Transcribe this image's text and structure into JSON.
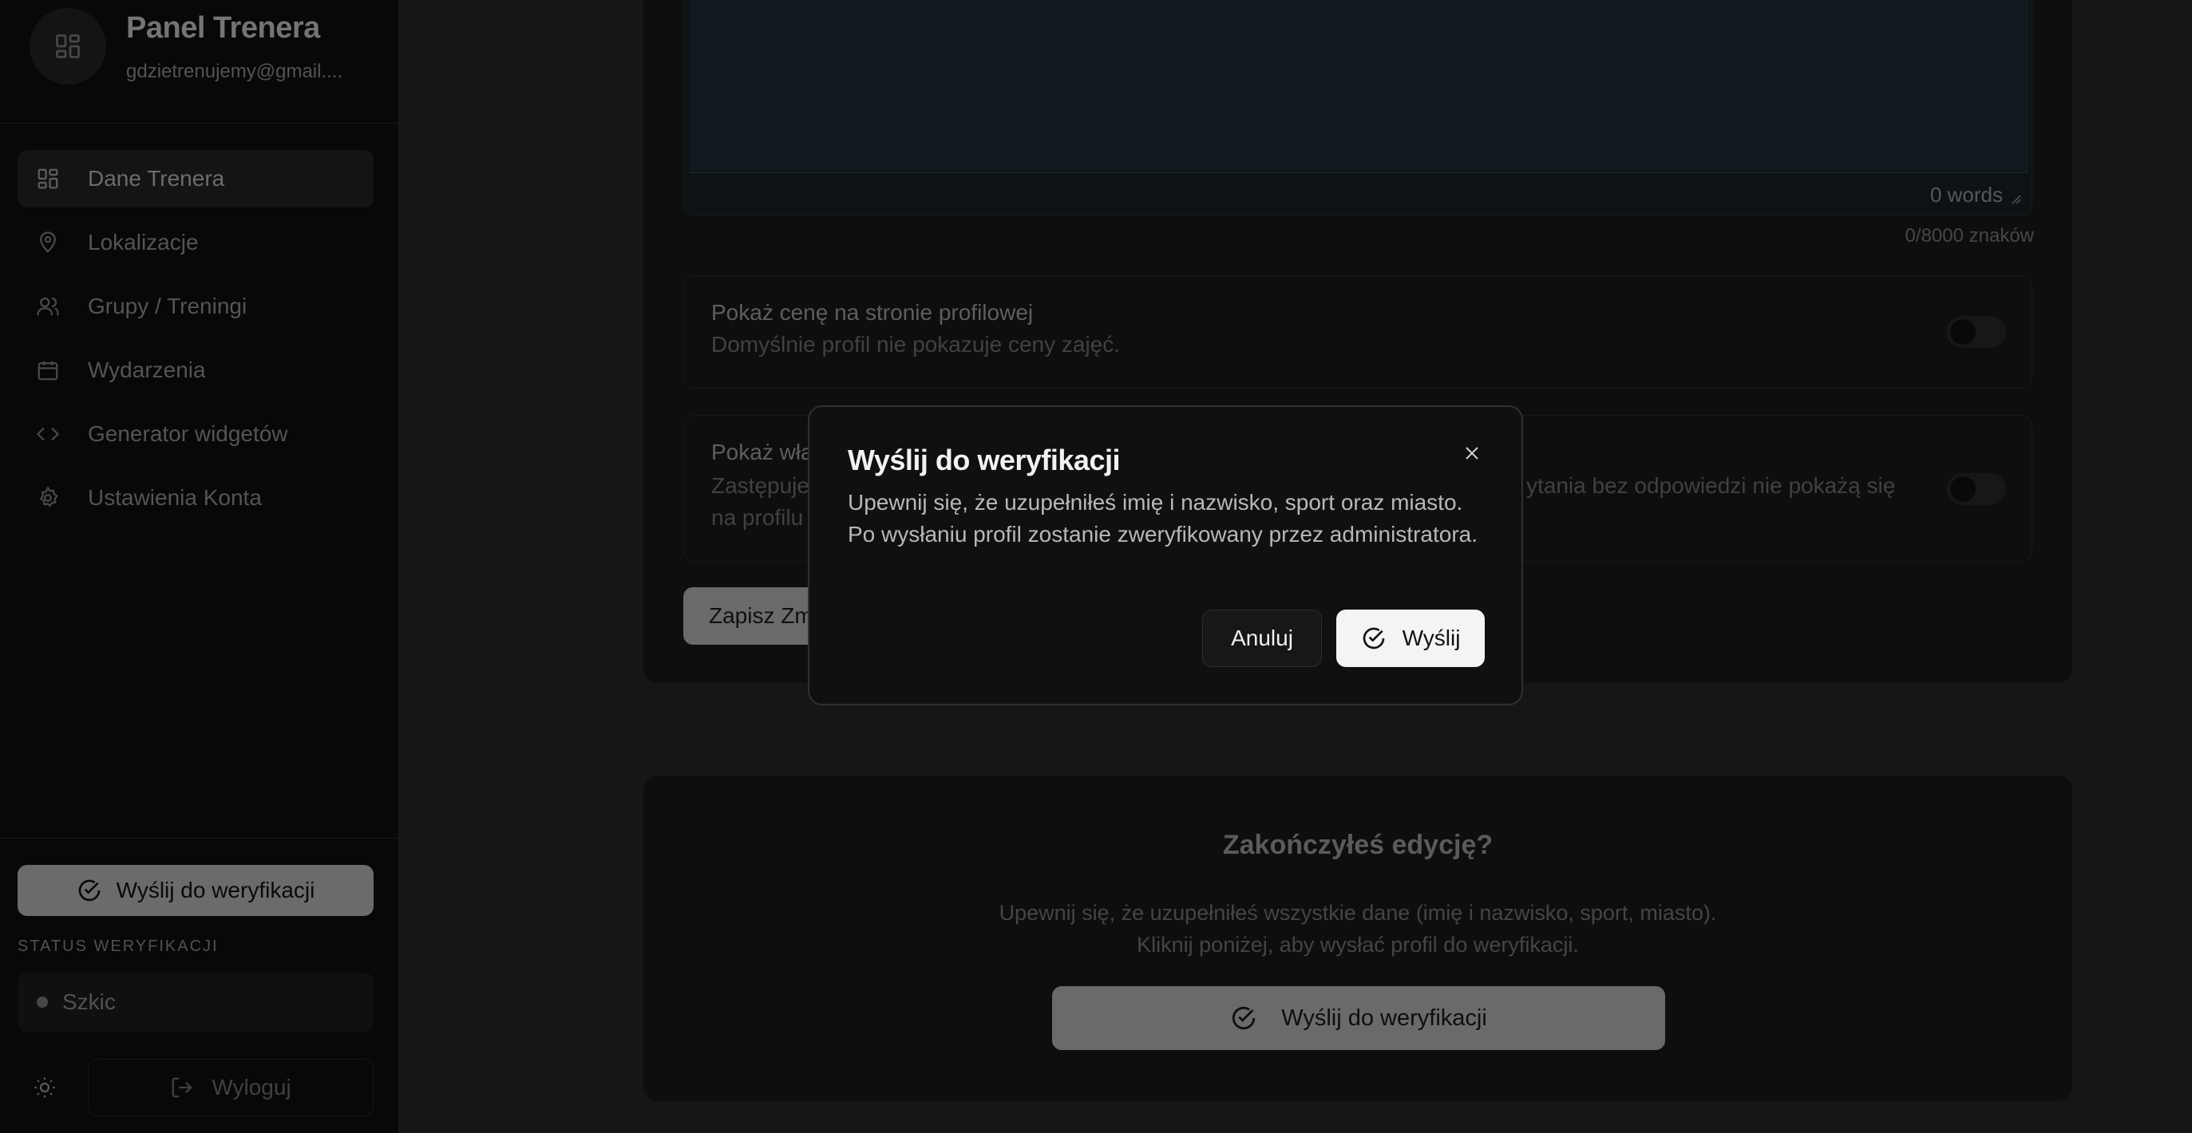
{
  "sidebar": {
    "brand": {
      "title": "Panel Trenera",
      "email": "gdzietrenujemy@gmail...."
    },
    "items": [
      {
        "label": "Dane Trenera",
        "icon": "dashboard-icon",
        "active": true
      },
      {
        "label": "Lokalizacje",
        "icon": "map-pin-icon"
      },
      {
        "label": "Grupy / Treningi",
        "icon": "users-icon"
      },
      {
        "label": "Wydarzenia",
        "icon": "calendar-icon"
      },
      {
        "label": "Generator widgetów",
        "icon": "code-icon"
      },
      {
        "label": "Ustawienia Konta",
        "icon": "gear-icon"
      }
    ],
    "verify_label": "Wyślij do weryfikacji",
    "status_label": "STATUS WERYFIKACJI",
    "status_value": "Szkic",
    "logout_label": "Wyloguj"
  },
  "editor": {
    "words": "0 words",
    "char_count": "0/8000 znaków"
  },
  "options": [
    {
      "title": "Pokaż cenę na stronie profilowej",
      "desc": "Domyślnie profil nie pokazuje ceny zajęć."
    },
    {
      "title": "Pokaż wła",
      "desc_left": "Zastępuje",
      "desc_left2": "na profilu",
      "desc_right": "ytania bez odpowiedzi nie pokażą się"
    }
  ],
  "save_label": "Zapisz Zm",
  "finish_card": {
    "title": "Zakończyłeś edycję?",
    "desc_line1": "Upewnij się, że uzupełniłeś wszystkie dane (imię i nazwisko, sport, miasto).",
    "desc_line2": "Kliknij poniżej, aby wysłać profil do weryfikacji.",
    "button": "Wyślij do weryfikacji"
  },
  "modal": {
    "title": "Wyślij do weryfikacji",
    "text": "Upewnij się, że uzupełniłeś imię i nazwisko, sport oraz miasto. Po wysłaniu profil zostanie zweryfikowany przez administratora.",
    "cancel": "Anuluj",
    "send": "Wyślij"
  }
}
